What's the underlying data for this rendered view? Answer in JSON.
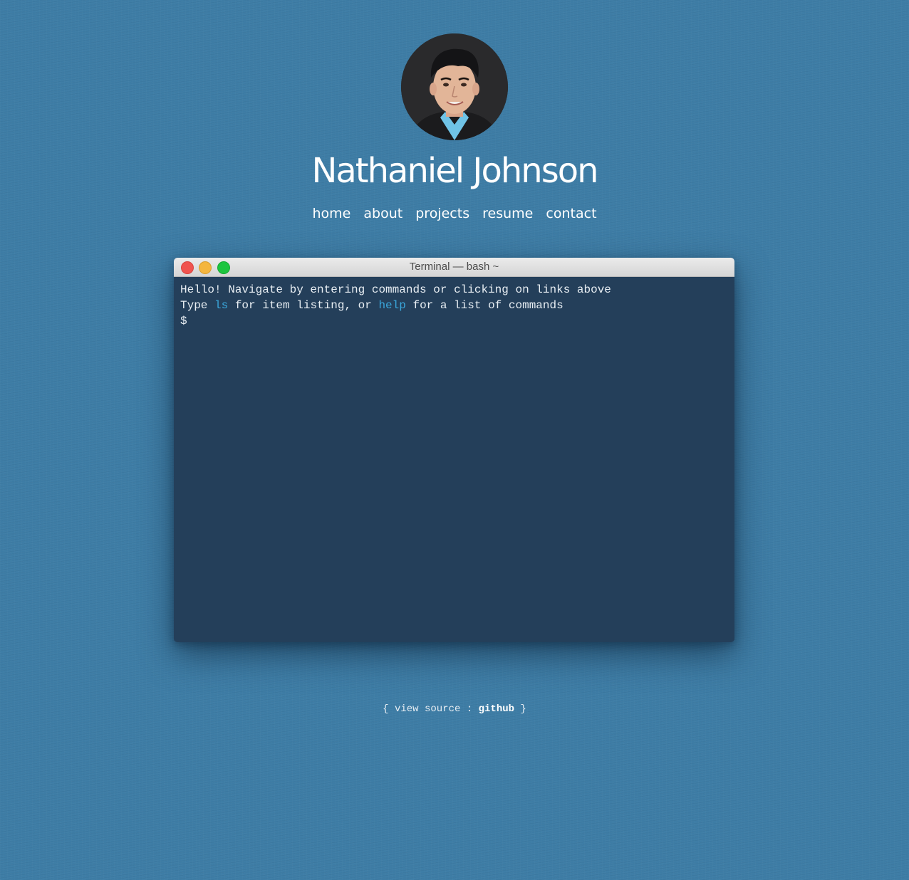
{
  "profile": {
    "name": "Nathaniel Johnson"
  },
  "nav": {
    "items": [
      {
        "label": "home"
      },
      {
        "label": "about"
      },
      {
        "label": "projects"
      },
      {
        "label": "resume"
      },
      {
        "label": "contact"
      }
    ]
  },
  "terminal": {
    "title": "Terminal — bash ~",
    "line1": "Hello! Navigate by entering commands or clicking on links above",
    "line2_prefix": "Type ",
    "cmd_ls": "ls",
    "line2_mid": " for item listing, or ",
    "cmd_help": "help",
    "line2_suffix": " for a list of commands",
    "prompt": "$"
  },
  "footer": {
    "open_brace": "{ ",
    "view_source": "view source",
    "separator": " : ",
    "github": "github",
    "close_brace": " }"
  },
  "colors": {
    "background": "#3d7ca5",
    "terminal_bg": "#243f5a",
    "command_link": "#3aa7dc",
    "close_dot": "#f0544f",
    "minimize_dot": "#f4b63f",
    "maximize_dot": "#1dc53f"
  }
}
